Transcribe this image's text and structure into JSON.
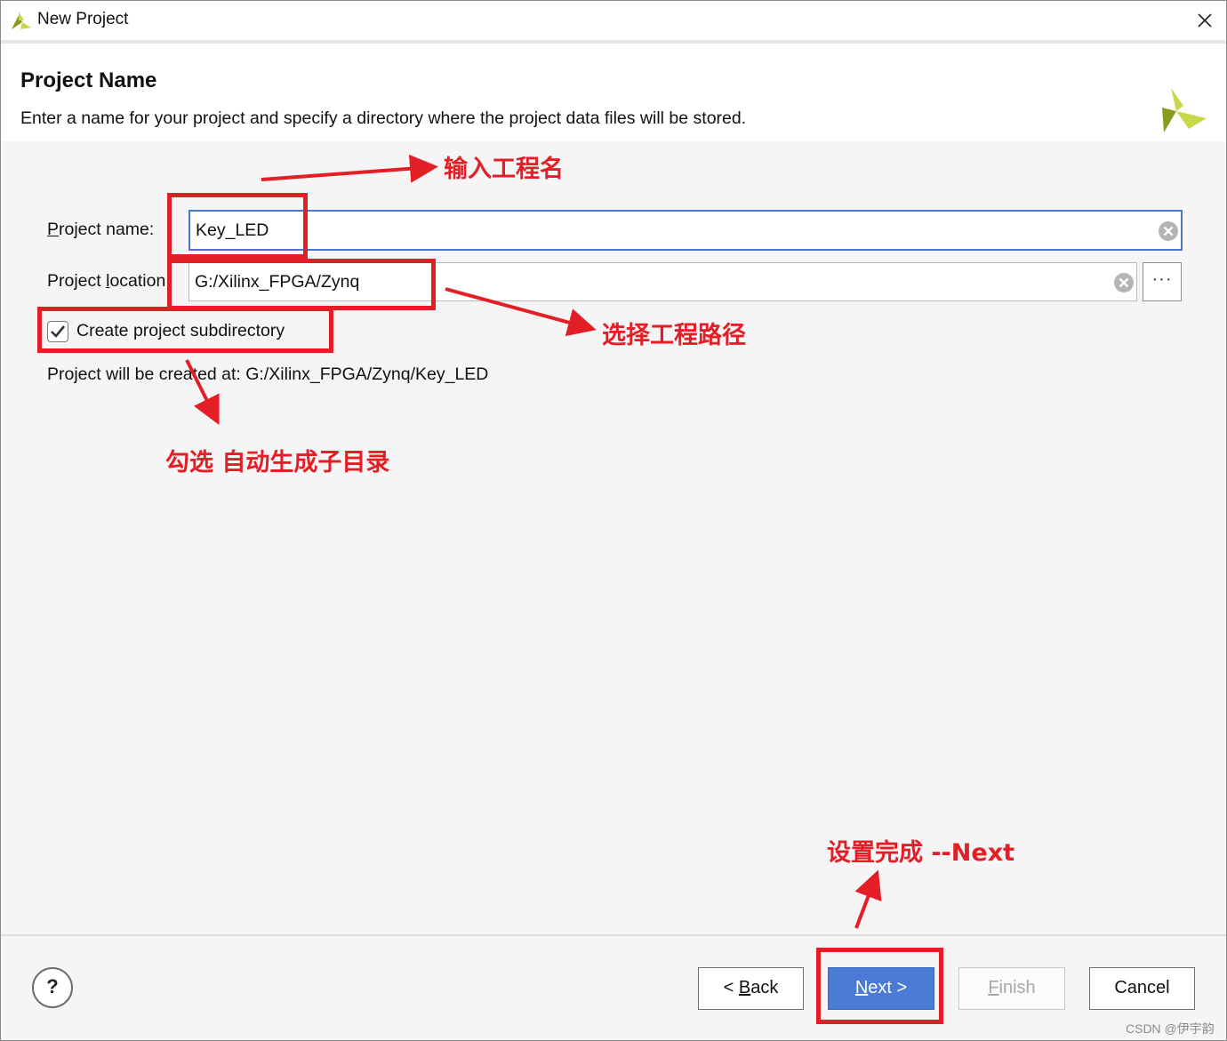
{
  "window": {
    "title": "New Project"
  },
  "header": {
    "title": "Project Name",
    "description": "Enter a name for your project and specify a directory where the project data files will be stored."
  },
  "form": {
    "project_name_label_prefix": "P",
    "project_name_label_rest": "roject name:",
    "project_name_value": "Key_LED",
    "project_location_label_a": "Project ",
    "project_location_label_u": "l",
    "project_location_label_b": "ocation:",
    "project_location_value": "G:/Xilinx_FPGA/Zynq",
    "browse_label": "···",
    "subdirectory_label": "Create project subdirectory",
    "subdirectory_checked": true,
    "created_at_text": "Project will be created at: G:/Xilinx_FPGA/Zynq/Key_LED"
  },
  "footer": {
    "help_label": "?",
    "back_prefix": "< ",
    "back_u": "B",
    "back_rest": "ack",
    "next_u": "N",
    "next_rest": "ext >",
    "finish_u": "F",
    "finish_rest": "inish",
    "cancel_label": "Cancel"
  },
  "annotations": {
    "name_note": "输入工程名",
    "location_note": "选择工程路径",
    "subdir_note": "勾选 自动生成子目录",
    "next_note": "设置完成 --Next"
  },
  "watermark": "CSDN @伊宇韵",
  "colors": {
    "accent": "#4c7bd6",
    "annotation": "#e41e26",
    "logo_light": "#c8d84a",
    "logo_dark": "#8a9a1c"
  }
}
